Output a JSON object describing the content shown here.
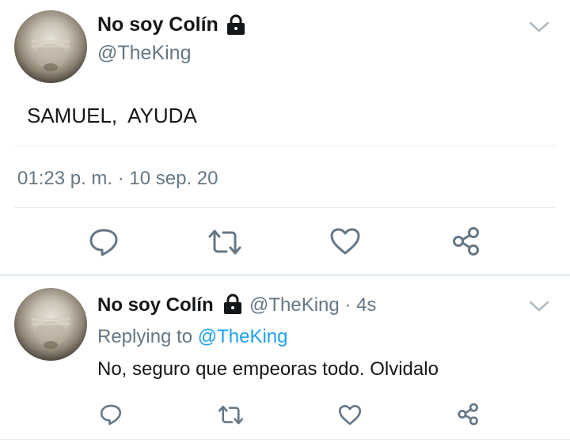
{
  "main_tweet": {
    "display_name": "No soy Colín",
    "handle": "@TheKing",
    "text": "SAMUEL,  AYUDA",
    "timestamp": "01:23 p. m. · 10 sep. 20",
    "actions": {
      "reply_icon": "reply-icon",
      "retweet_icon": "retweet-icon",
      "like_icon": "heart-icon",
      "share_icon": "share-icon"
    }
  },
  "reply_tweet": {
    "display_name": "No soy Colín",
    "handle_time": "@TheKing · 4s",
    "replying_prefix": "Replying to",
    "replying_handle": "@TheKing",
    "text": "No, seguro que empeoras todo. Olvidalo"
  },
  "colors": {
    "link": "#1da1f2",
    "secondary_text": "#657786",
    "icon": "#657786",
    "divider": "#e6ecf0"
  }
}
